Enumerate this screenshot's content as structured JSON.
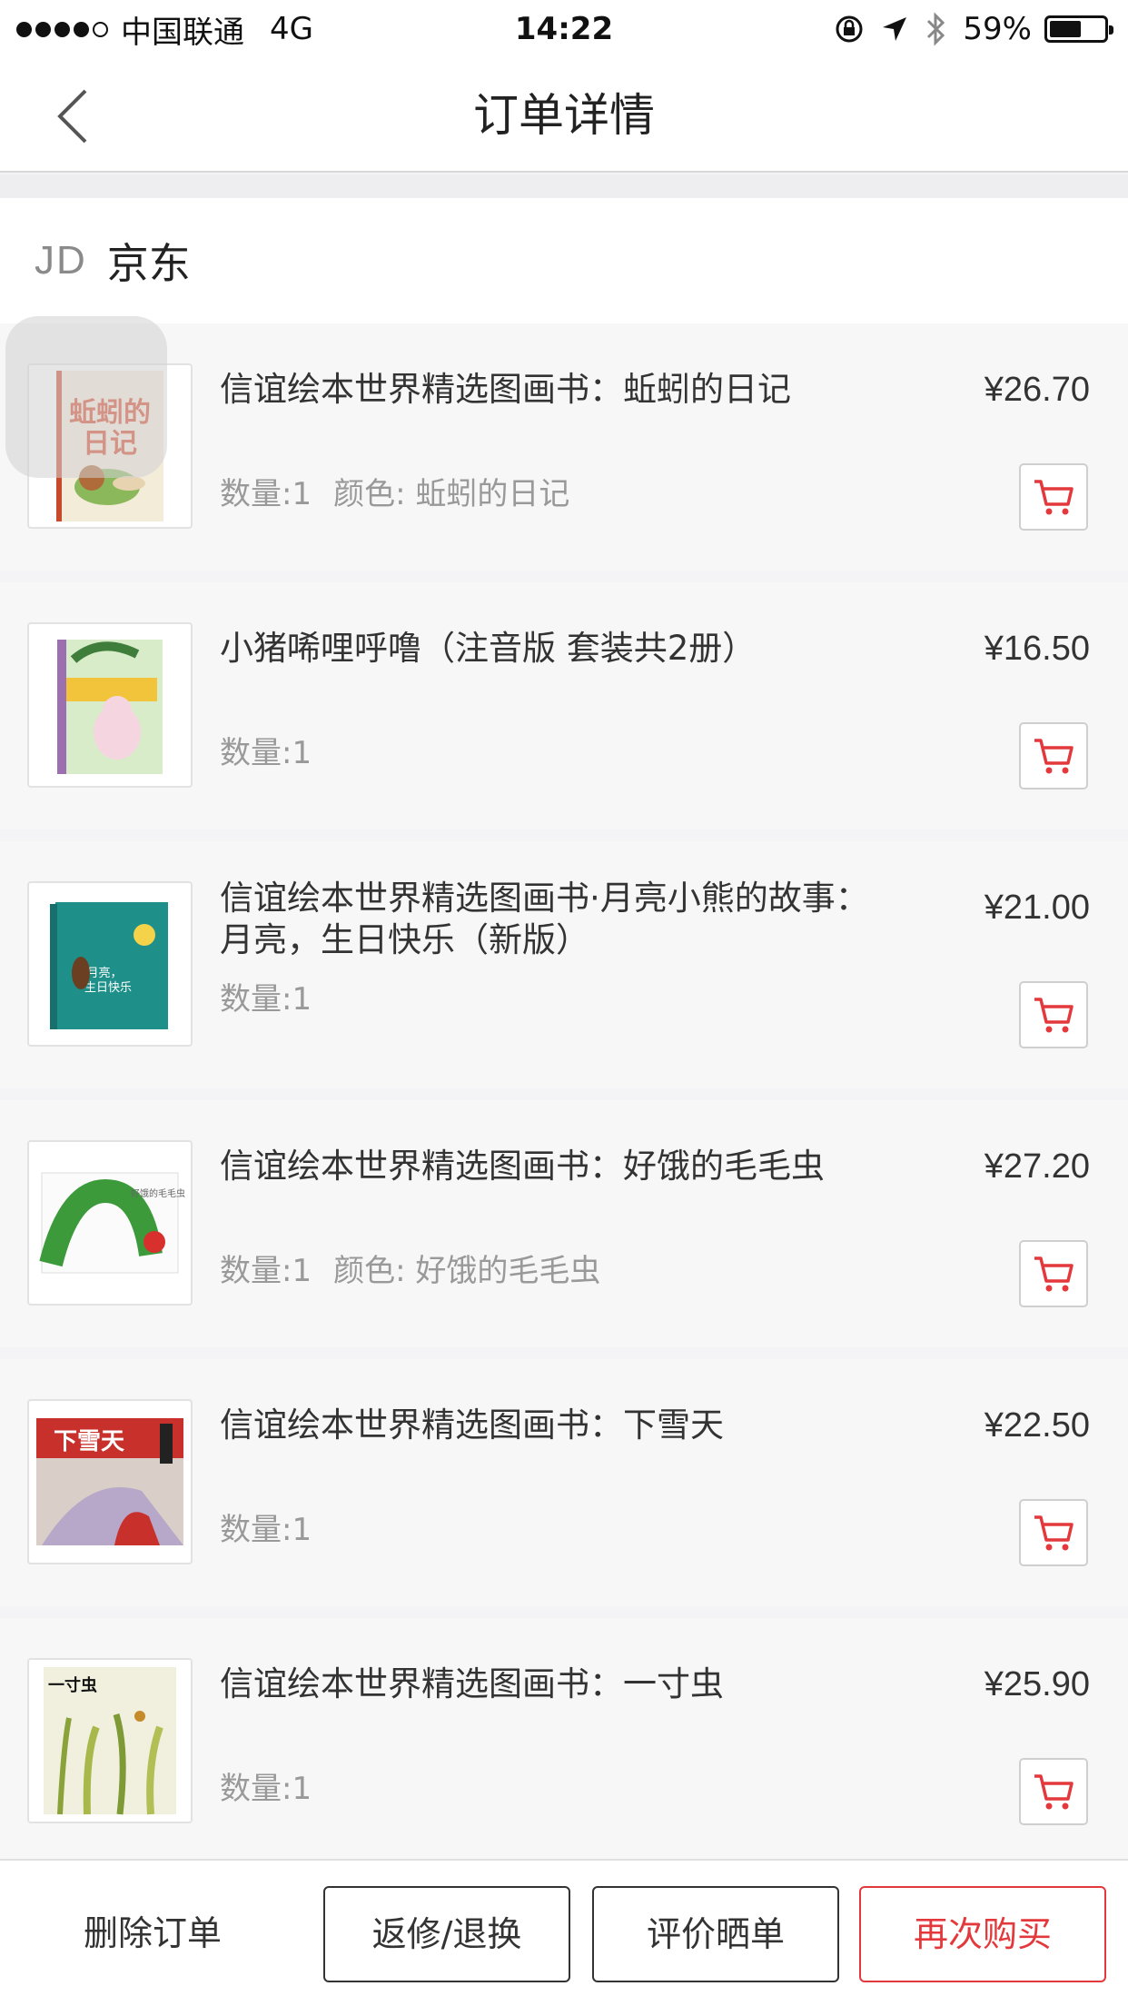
{
  "status_bar": {
    "carrier": "中国联通",
    "network": "4G",
    "time": "14:22",
    "battery_percent": "59%",
    "battery_level": 0.59
  },
  "nav": {
    "title": "订单详情",
    "back_icon": "chevron-left-icon"
  },
  "shop": {
    "logo": "JD",
    "name": "京东"
  },
  "items": [
    {
      "title": "信谊绘本世界精选图画书：蚯蚓的日记",
      "price": "¥26.70",
      "quantity": "数量:1",
      "color": "颜色: 蚯蚓的日记"
    },
    {
      "title": "小猪唏哩呼噜（注音版 套装共2册）",
      "price": "¥16.50",
      "quantity": "数量:1",
      "color": ""
    },
    {
      "title": "信谊绘本世界精选图画书·月亮小熊的故事：月亮，生日快乐（新版）",
      "price": "¥21.00",
      "quantity": "数量:1",
      "color": ""
    },
    {
      "title": "信谊绘本世界精选图画书：好饿的毛毛虫",
      "price": "¥27.20",
      "quantity": "数量:1",
      "color": "颜色: 好饿的毛毛虫"
    },
    {
      "title": "信谊绘本世界精选图画书：下雪天",
      "price": "¥22.50",
      "quantity": "数量:1",
      "color": ""
    },
    {
      "title": "信谊绘本世界精选图画书：一寸虫",
      "price": "¥25.90",
      "quantity": "数量:1",
      "color": ""
    }
  ],
  "book_cover_text": {
    "cover1": "蚯蚓的日记",
    "cover3": "月亮，生日快乐",
    "cover4": "好饿的毛毛虫",
    "cover5": "下雪天",
    "cover6": "一寸虫"
  },
  "bottom": {
    "delete_label": "删除订单",
    "return_label": "返修/退换",
    "review_label": "评价晒单",
    "rebuy_label": "再次购买"
  },
  "colors": {
    "accent_red": "#e4393c",
    "text_dark": "#333333",
    "text_gray": "#999999",
    "item_bg": "#f7f7f7"
  }
}
